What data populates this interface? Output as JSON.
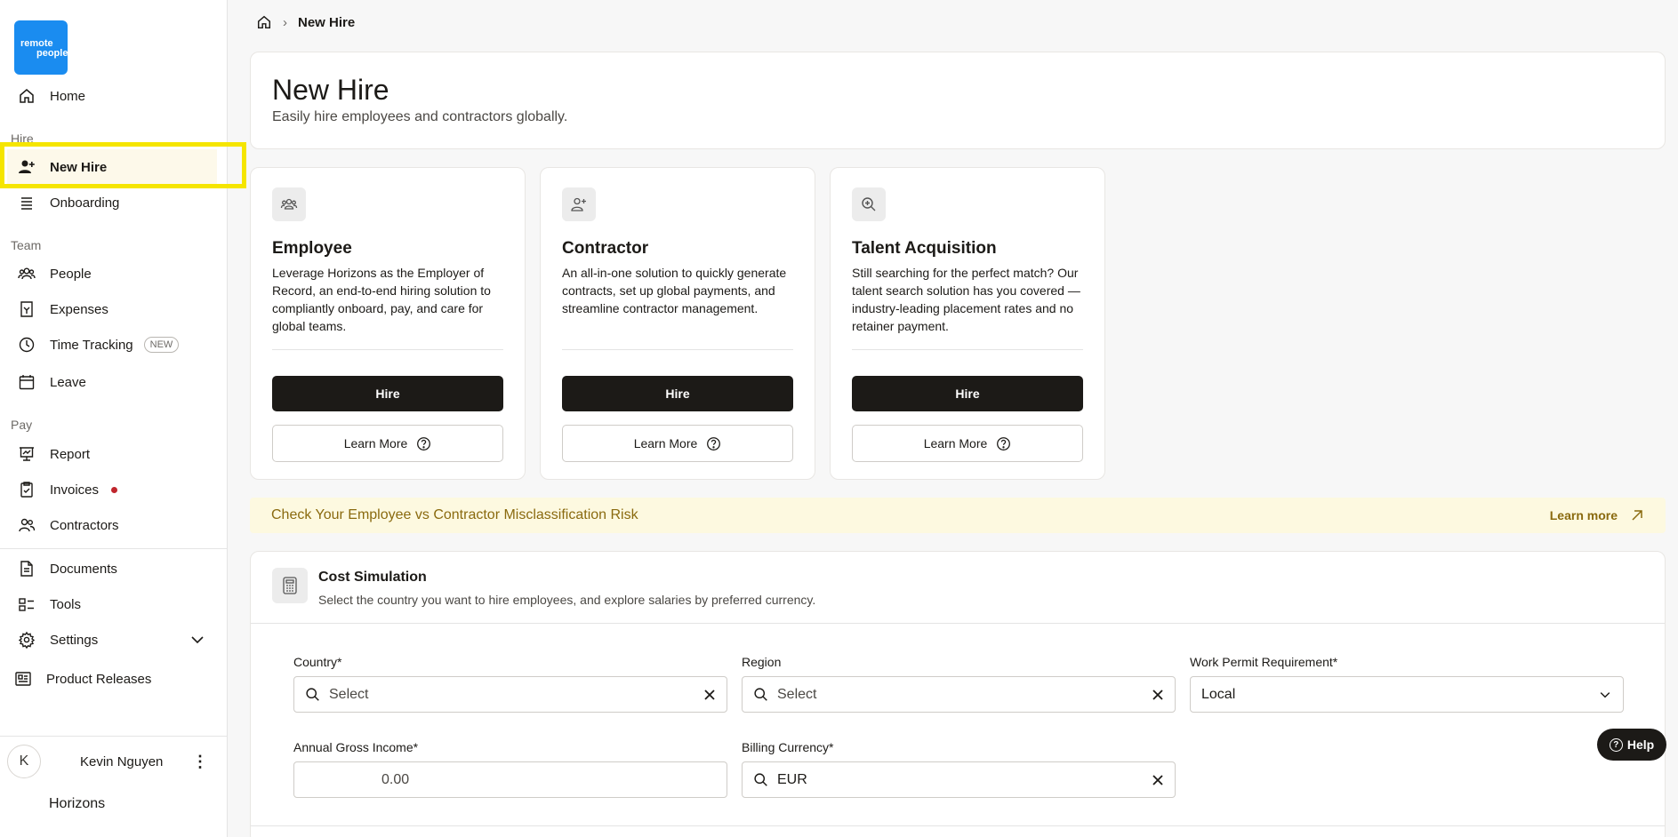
{
  "brand": {
    "logo_line1": "remote",
    "logo_line2": "people",
    "company": "Horizons"
  },
  "sidebar": {
    "home": "Home",
    "sections": {
      "hire": "Hire",
      "team": "Team",
      "pay": "Pay"
    },
    "items": {
      "new_hire": "New Hire",
      "onboarding": "Onboarding",
      "people": "People",
      "expenses": "Expenses",
      "time_tracking": "Time Tracking",
      "time_tracking_badge": "NEW",
      "leave": "Leave",
      "report": "Report",
      "invoices": "Invoices",
      "contractors": "Contractors",
      "documents": "Documents",
      "tools": "Tools",
      "settings": "Settings",
      "product_releases": "Product Releases"
    },
    "user": {
      "initial": "K",
      "name": "Kevin Nguyen"
    }
  },
  "breadcrumb": {
    "current": "New Hire"
  },
  "header": {
    "title": "New Hire",
    "subtitle": "Easily hire employees and contractors globally."
  },
  "cards": [
    {
      "title": "Employee",
      "description": "Leverage Horizons as the Employer of Record, an end-to-end hiring solution to compliantly onboard, pay, and care for global teams.",
      "primary": "Hire",
      "secondary": "Learn More"
    },
    {
      "title": "Contractor",
      "description": "An all-in-one solution to quickly generate contracts, set up global payments, and streamline contractor management.",
      "primary": "Hire",
      "secondary": "Learn More"
    },
    {
      "title": "Talent Acquisition",
      "description": "Still searching for the perfect match? Our talent search solution has you covered — industry-leading placement rates and no retainer payment.",
      "primary": "Hire",
      "secondary": "Learn More"
    }
  ],
  "banner": {
    "text": "Check Your Employee vs Contractor Misclassification Risk",
    "link": "Learn more"
  },
  "cost_simulation": {
    "title": "Cost Simulation",
    "subtitle": "Select the country you want to hire employees, and explore salaries by preferred currency.",
    "fields": {
      "country_label": "Country*",
      "country_placeholder": "Select",
      "region_label": "Region",
      "region_placeholder": "Select",
      "permit_label": "Work Permit Requirement*",
      "permit_value": "Local",
      "income_label": "Annual Gross Income*",
      "income_value": "0.00",
      "currency_label": "Billing Currency*",
      "currency_value": "EUR"
    }
  },
  "help": {
    "label": "Help",
    "icon": "?"
  },
  "colors": {
    "accent_dark": "#1c1a17",
    "logo_blue": "#1a8cf0",
    "highlight": "#f5e500",
    "banner_bg": "#fdf9e0",
    "banner_text": "#8a6a0f"
  }
}
